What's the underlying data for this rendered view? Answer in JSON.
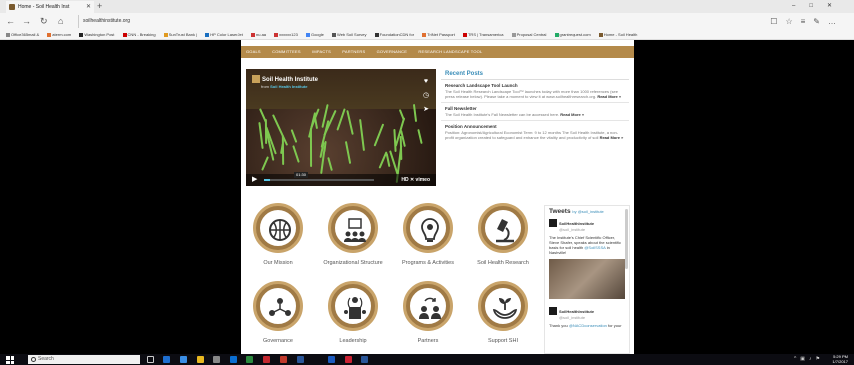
{
  "browser": {
    "tab_title": "Home - Soil Health Inst",
    "new_tab": "+",
    "url": "soilhealthinstitute.org",
    "favorites": [
      "Office365mail &",
      "aterm.com",
      "Washington Post",
      "CNN - Breaking",
      "SunTrust Bank |",
      "HP Color LaserJet",
      "nu.aa",
      "xxxxxx123",
      "Google",
      "Web Soil Survey",
      "FoundationCDN for",
      "TriNet Passport",
      "TRS | Transamerica",
      "Proposal Central",
      "grantrequest.com",
      "Home - Soil Health"
    ]
  },
  "site": {
    "menu": [
      "GOALS",
      "COMMITTEES",
      "IMPACTS",
      "PARTNERS",
      "GOVERNANCE",
      "RESEARCH LANDSCAPE TOOL"
    ],
    "video": {
      "title": "Soil Health Institute",
      "from_label": "from",
      "from_channel": "Soil Health Institute",
      "time": "01:30",
      "controls_right": "HD  ✕  vimeo"
    },
    "recent": {
      "heading": "Recent Posts",
      "posts": [
        {
          "title": "Research Landscape Tool Launch",
          "body": "The Soil Health Research Landscape Tool™ launches today with more than 1000 references (see press release below). Please take a moment to view it at www.soilhealthresearch.org.",
          "more": "Read More »"
        },
        {
          "title": "Fall Newsletter",
          "body": "The Soil Health Institute's Fall Newsletter can be accessed here.",
          "more": "Read More »"
        },
        {
          "title": "Position Announcement",
          "body": "Position: Agronomist/Agricultural Economist Term: 9 to 12 months The Soil Health Institute, a non-profit organization created to safeguard and enhance the vitality and productivity of soil",
          "more": "Read More »"
        }
      ]
    },
    "icons": [
      {
        "label": "Our Mission"
      },
      {
        "label": "Organizational Structure"
      },
      {
        "label": "Programs & Activities"
      },
      {
        "label": "Soil Health Research"
      },
      {
        "label": "Governance"
      },
      {
        "label": "Leadership"
      },
      {
        "label": "Partners"
      },
      {
        "label": "Support SHI"
      }
    ],
    "tweets": {
      "heading": "Tweets",
      "by": "by @soil_institute",
      "items": [
        {
          "name": "SoilHealthInstitute",
          "handle": "@soil_institute",
          "text": "The Institute's Chief Scientific Officer, Steve Shafer, speaks about the scientific basis for soil health",
          "link": "@SoilSSSA",
          "tail": "in Nashville!"
        },
        {
          "name": "SoilHealthInstitute",
          "handle": "@soil_institute",
          "text": "Thank you",
          "link": "@NACDconservation",
          "tail": "for your"
        }
      ]
    }
  },
  "taskbar": {
    "search_placeholder": "Search",
    "time": "5:29 PM",
    "date": "1/7/2017"
  }
}
